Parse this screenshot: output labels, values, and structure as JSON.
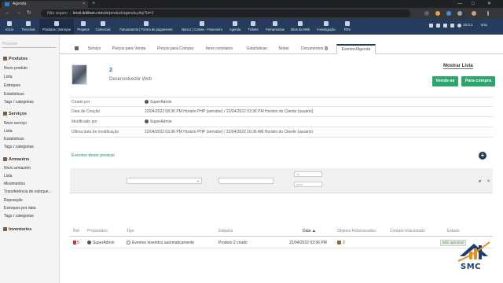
{
  "browser": {
    "tab_title": "Agenda",
    "security_label": "Não seguro",
    "url_host": "local.dolibarr.com.br",
    "url_path": "/product/agenda.php?id=1",
    "close_glyph": "×",
    "newtab_glyph": "+",
    "win_min": "—",
    "win_max": "□",
    "win_close": "✕"
  },
  "topmenu": {
    "items": [
      "Início",
      "Terceiros",
      "Produtos | Serviços",
      "Projetos",
      "Comercial",
      "Faturamento | Forma de pagamento",
      "Banco | Contas - Financeiro",
      "Agenda",
      "Tickets",
      "Ferramentas",
      "Sites da Web",
      "Investigação",
      "PDV"
    ],
    "version": "15.0.1",
    "user": "smc"
  },
  "sidebar": {
    "search_placeholder": "Procurar",
    "sections": [
      {
        "title": "Produtos",
        "links": [
          "Novo produto",
          "Lista",
          "Estoques",
          "Estatísticas",
          "Tags / categorias"
        ]
      },
      {
        "title": "Serviços",
        "links": [
          "Novo serviço",
          "Lista",
          "Estatísticas",
          "Tags / categorias"
        ]
      },
      {
        "title": "Armazéns",
        "links": [
          "Novo armazém",
          "Lista",
          "Movimentos",
          "Transferência de estoque...",
          "Reposição",
          "Estoques por data",
          "Tags / categorias"
        ]
      },
      {
        "title": "Inventories",
        "links": []
      }
    ]
  },
  "tabs": [
    "Serviço",
    "Preços para Venda",
    "Preços para Compra",
    "Itens correlatos",
    "Estatísticas",
    "Notas",
    "Documentos",
    "Eventos/Agenda"
  ],
  "documents_badge": "0",
  "product": {
    "ref": "2",
    "label": "Desenvolvedor Web",
    "show_list": "Mostrar Lista",
    "sell_button": "Vende-se",
    "buy_button": "Para compra"
  },
  "info": [
    {
      "label": "Criado por",
      "value": "SuperAdmin"
    },
    {
      "label": "Data de Criação",
      "value": "22/04/2022 08:36 PM Horário PHP (servidor)   /   22/04/2022 03:36 PM  Horário do Cliente (usuário)"
    },
    {
      "label": "Modificado por",
      "value": "SuperAdmin"
    },
    {
      "label": "Última data de modificação",
      "value": "22/04/2022 03:36 PM Horário PHP (servidor)   /   22/04/2022 10:36 AM  Horário do Cliente (usuário)"
    }
  ],
  "events": {
    "title": "Eventos deste produto",
    "add_glyph": "+",
    "filter_date_from": "de",
    "filter_date_to": "para",
    "search_glyph": "⌕",
    "clear_glyph": "✕",
    "columns": [
      "Ref.",
      "Proprietário",
      "Tipo",
      "Etiqueta",
      "Data ▲",
      "Objetos Relacionados",
      "Contato relacionado",
      "Estado"
    ],
    "rows": [
      {
        "ref": "5",
        "owner": "SuperAdmin",
        "type": "Eventos inseridos automaticamente",
        "label": "Produto 2 criado",
        "date": "22/04/2022 03:36 PM",
        "related": "2",
        "contact": "",
        "status": "Não aplicável"
      }
    ]
  },
  "watermark": {
    "text": "SMC"
  }
}
